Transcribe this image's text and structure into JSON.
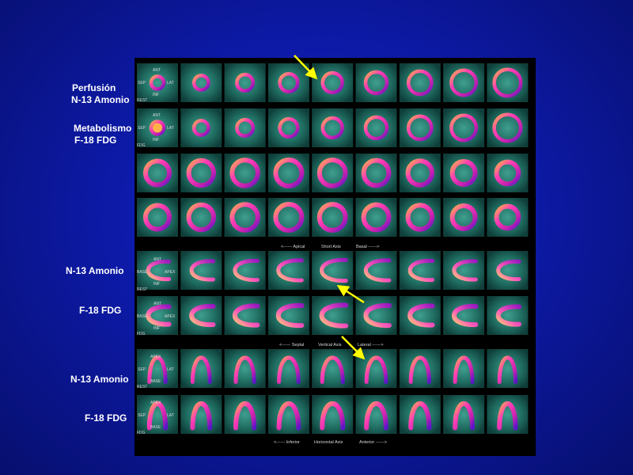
{
  "labels": {
    "perfusion_title": "Perfusión",
    "perfusion_tracer": "N-13 Amonio",
    "metabolism_title": "Metabolismo",
    "metabolism_tracer": "F-18 FDG",
    "vla_perfusion": "N-13 Amonio",
    "vla_metabolism": "F-18 FDG",
    "hla_perfusion": "N-13 Amonio",
    "hla_metabolism": "F-18 FDG"
  },
  "axes": {
    "short_axis": {
      "apical": "<------ Apical",
      "name": "Short Axis",
      "basal": "Basal ------>"
    },
    "vertical_axis": {
      "septal": "<------ Septal",
      "name": "Vertical Axis",
      "lateral": "Lateral ------>"
    },
    "horizontal_axis": {
      "inferior": "<------ Inferior",
      "name": "Horizontal Axis",
      "anterior": "Anterior ------>"
    }
  },
  "tile_labels": {
    "sa": {
      "ant": "ANT",
      "sep": "SEP",
      "lat": "LAT",
      "inf": "INF",
      "rest": "REST",
      "fdg": "FDG"
    },
    "vla": {
      "ant": "ANT",
      "base": "BASE",
      "apex": "APEX",
      "inf": "INF",
      "rest": "REST",
      "fdg": "FDG"
    },
    "hla": {
      "apex": "APEX",
      "sep": "SEP",
      "lat": "LAT",
      "base": "BASE",
      "rest": "REST",
      "fdg": "FDG"
    }
  },
  "colors": {
    "background": "#0d1aa8",
    "panel": "#000000",
    "arrow": "#ffff00",
    "scan_background": "#1f6b60"
  },
  "rows": [
    {
      "view": "short-axis",
      "tracer": "N-13 Amonio"
    },
    {
      "view": "short-axis",
      "tracer": "F-18 FDG"
    },
    {
      "view": "short-axis",
      "tracer": "N-13 Amonio"
    },
    {
      "view": "short-axis",
      "tracer": "F-18 FDG"
    },
    {
      "view": "vertical-long-axis",
      "tracer": "N-13 Amonio"
    },
    {
      "view": "vertical-long-axis",
      "tracer": "F-18 FDG"
    },
    {
      "view": "horizontal-long-axis",
      "tracer": "N-13 Amonio"
    },
    {
      "view": "horizontal-long-axis",
      "tracer": "F-18 FDG"
    }
  ],
  "slices_per_row": 9
}
